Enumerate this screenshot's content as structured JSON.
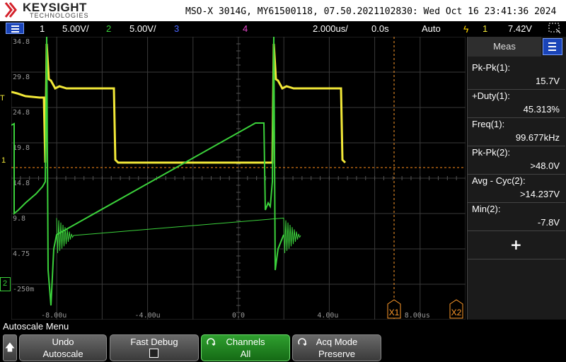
{
  "header": {
    "brand": "KEYSIGHT",
    "brand_sub": "TECHNOLOGIES",
    "scope_info": "MSO-X 3014G, MY61500118, 07.50.2021102830: Wed Oct 16 23:41:36 2024"
  },
  "status_bar": {
    "ch1_num": "1",
    "ch1_scale": "5.00V/",
    "ch2_num": "2",
    "ch2_scale": "5.00V/",
    "ch3_num": "3",
    "ch4_num": "4",
    "timebase": "2.000us/",
    "delay": "0.0s",
    "trigger_mode": "Auto",
    "trigger_source": "1",
    "trigger_level": "7.42V"
  },
  "colors": {
    "ch1": "#f2e838",
    "ch2": "#3bd13b",
    "ch3": "#4a66ff",
    "ch4": "#e84acb",
    "trigger": "#ff8c1a",
    "grid": "#3a3a3a"
  },
  "grid_labels": {
    "y": [
      "34.8",
      "29.8",
      "24.8",
      "19.8",
      "14.8",
      "9.8",
      "4.75",
      "-250m"
    ],
    "x": [
      "-8.00u",
      "-4.00u",
      "0.0",
      "4.00u",
      "8.00us"
    ],
    "cursor_x1": "X1",
    "cursor_x2": "X2",
    "ch1_marker": "1",
    "ch2_marker": "2",
    "trigger_marker": "T"
  },
  "measurements": {
    "tab_label": "Meas",
    "items": [
      {
        "label": "Pk-Pk(1):",
        "value": "15.7V"
      },
      {
        "label": "+Duty(1):",
        "value": "45.313%"
      },
      {
        "label": "Freq(1):",
        "value": "99.677kHz"
      },
      {
        "label": "Pk-Pk(2):",
        "value": ">48.0V"
      },
      {
        "label": "Avg - Cyc(2):",
        "value": ">14.237V"
      },
      {
        "label": "Min(2):",
        "value": "-7.8V"
      }
    ],
    "add_label": "+"
  },
  "softkeys": {
    "menu_title": "Autoscale Menu",
    "up_icon": "up-arrow-icon",
    "undo": {
      "line1": "Undo",
      "line2": "Autoscale"
    },
    "fast_debug": {
      "line1": "Fast Debug"
    },
    "channels": {
      "line1": "Channels",
      "line2": "All"
    },
    "acq_mode": {
      "line1": "Acq Mode",
      "line2": "Preserve"
    }
  }
}
